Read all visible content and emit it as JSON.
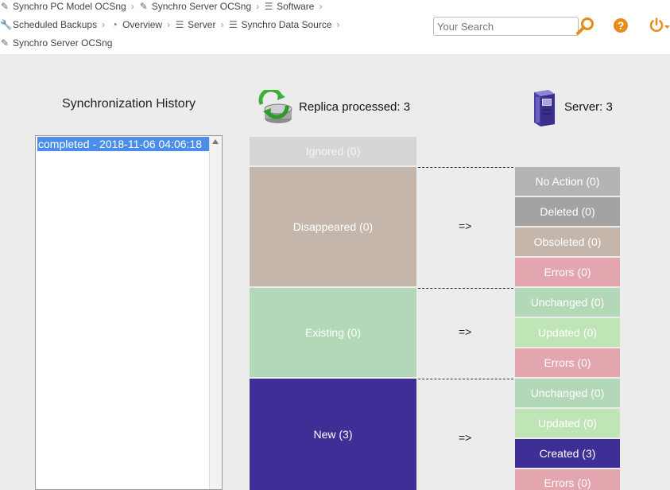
{
  "breadcrumb": {
    "row1": [
      {
        "icon": "synchro-icon",
        "label": "Synchro PC Model OCSng"
      },
      {
        "icon": "synchro-icon",
        "label": "Synchro Server OCSng"
      },
      {
        "icon": "list-icon",
        "label": "Software"
      }
    ],
    "row2": [
      {
        "icon": "wrench-icon",
        "label": "Scheduled Backups"
      },
      {
        "icon": "pie-chart-icon",
        "label": "Overview"
      },
      {
        "icon": "list-icon",
        "label": "Server"
      },
      {
        "icon": "list-icon",
        "label": "Synchro Data Source"
      }
    ],
    "row3": [
      {
        "icon": "synchro-icon",
        "label": "Synchro Server OCSng"
      }
    ]
  },
  "search": {
    "placeholder": "Your Search"
  },
  "colors": {
    "accent": "#e88b1a",
    "selected": "#4a8ee8",
    "ignored": "#d6d6d6",
    "disappeared": "#c4b6aa",
    "existing": "#b3d8b8",
    "new": "#3d2f96",
    "no_action": "#b4b4b4",
    "deleted": "#a3a3a3",
    "obsoleted": "#c4b6aa",
    "errors": "#e3a5ae",
    "unchanged": "#b3d8b8",
    "updated": "#bfe5b6",
    "created": "#3d2f96"
  },
  "history": {
    "title": "Synchronization History",
    "items": [
      "completed - 2018-11-06 04:06:18"
    ]
  },
  "replica": {
    "label": "Replica processed: 3"
  },
  "server": {
    "label": "Server: 3"
  },
  "source_blocks": {
    "ignored": "Ignored (0)",
    "disappeared": "Disappeared (0)",
    "existing": "Existing (0)",
    "new": "New (3)"
  },
  "arrow": "=>",
  "target_blocks": {
    "no_action": "No Action (0)",
    "deleted": "Deleted (0)",
    "obsoleted": "Obsoleted (0)",
    "errors_1": "Errors (0)",
    "unchanged_1": "Unchanged (0)",
    "updated_1": "Updated (0)",
    "errors_2": "Errors (0)",
    "unchanged_2": "Unchanged (0)",
    "updated_2": "Updated (0)",
    "created": "Created (3)",
    "errors_3": "Errors (0)"
  }
}
